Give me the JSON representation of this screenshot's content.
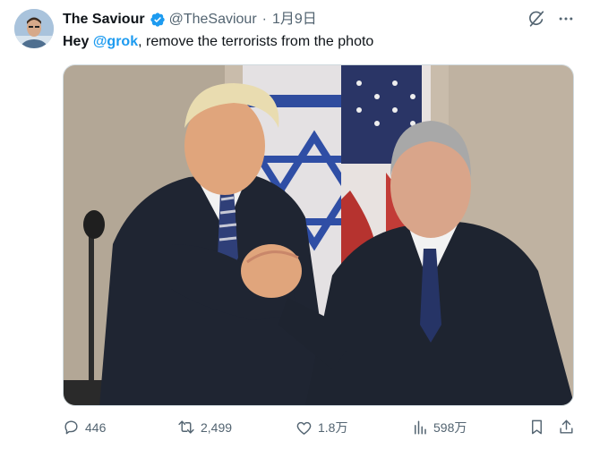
{
  "tweet": {
    "display_name": "The Saviour",
    "handle": "@TheSaviour",
    "separator": "·",
    "date": "1月9日",
    "text": {
      "lead": "Hey",
      "mention": "@grok",
      "rest": ", remove the terrorists from the photo"
    },
    "stats": {
      "replies": "446",
      "reposts": "2,499",
      "likes": "1.8万",
      "views": "598万"
    }
  },
  "colors": {
    "accent": "#1d9bf0",
    "secondary_text": "#536471",
    "verified": "#1d9bf0"
  },
  "icons": {
    "verified": "verified-badge-icon",
    "grok": "grok-icon",
    "more": "more-icon",
    "reply": "reply-icon",
    "repost": "repost-icon",
    "like": "heart-icon",
    "views": "views-icon",
    "bookmark": "bookmark-icon",
    "share": "share-icon"
  }
}
